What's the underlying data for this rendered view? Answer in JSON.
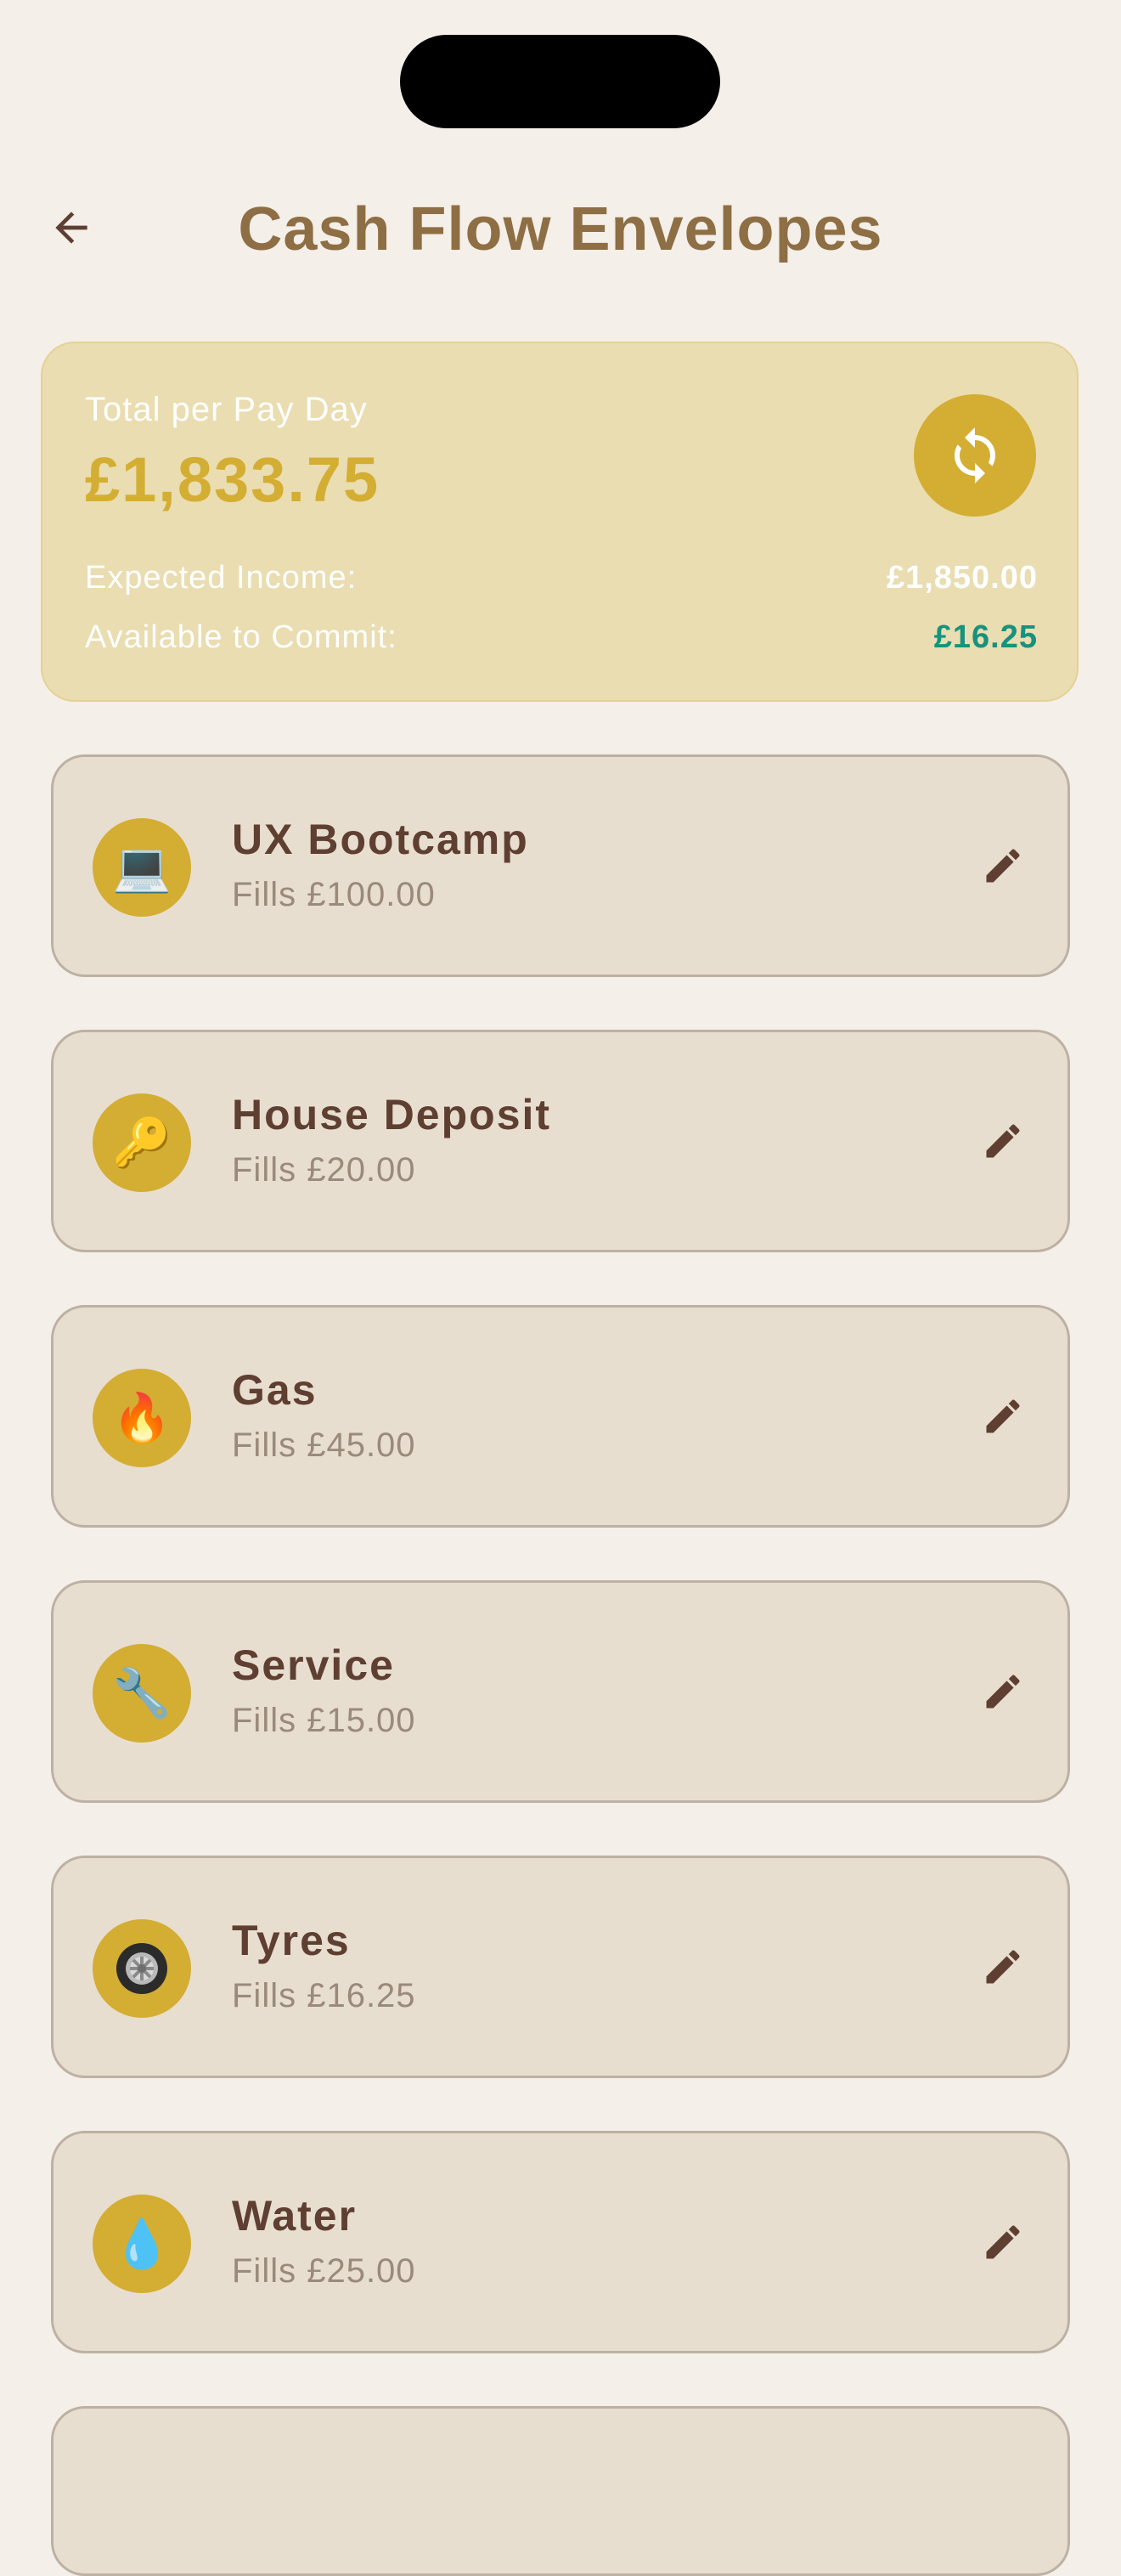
{
  "header": {
    "title": "Cash Flow Envelopes"
  },
  "summary": {
    "label": "Total per Pay Day",
    "total": "£1,833.75",
    "expected_income_label": "Expected Income:",
    "expected_income_value": "£1,850.00",
    "available_label": "Available to Commit:",
    "available_value": "£16.25"
  },
  "colors": {
    "accent": "#d4ad33",
    "title": "#8e6e44",
    "positive": "#16927d"
  },
  "envelopes": [
    {
      "name": "UX Bootcamp",
      "fill": "Fills £100.00",
      "icon": "💻",
      "icon_name": "laptop-icon"
    },
    {
      "name": "House Deposit",
      "fill": "Fills £20.00",
      "icon": "🔑",
      "icon_name": "key-icon"
    },
    {
      "name": "Gas",
      "fill": "Fills £45.00",
      "icon": "🔥",
      "icon_name": "fire-icon"
    },
    {
      "name": "Service",
      "fill": "Fills £15.00",
      "icon": "🔧",
      "icon_name": "wrench-icon"
    },
    {
      "name": "Tyres",
      "fill": "Fills £16.25",
      "icon": "🛞",
      "icon_name": "tyre-icon"
    },
    {
      "name": "Water",
      "fill": "Fills £25.00",
      "icon": "💧",
      "icon_name": "droplet-icon"
    }
  ]
}
